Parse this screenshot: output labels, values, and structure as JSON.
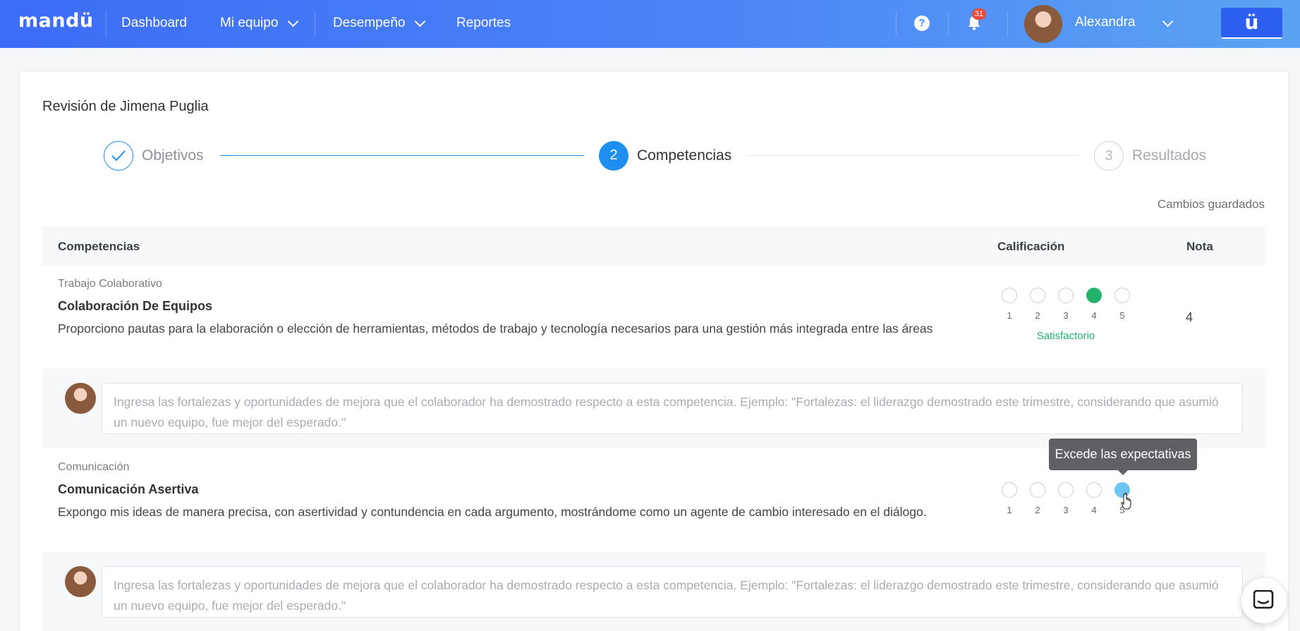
{
  "nav": {
    "logo": "mandü",
    "items": [
      {
        "label": "Dashboard"
      },
      {
        "label": "Mi equipo"
      },
      {
        "label": "Desempeño"
      },
      {
        "label": "Reportes"
      }
    ],
    "help_icon": "question-circle-icon",
    "notifications_count": "31",
    "user_name": "Alexandra",
    "brand_button": "ü",
    "accent_color": "#3d6cf5"
  },
  "review": {
    "title": "Revisión de Jimena Puglia",
    "steps": [
      {
        "number": "1",
        "label": "Objetivos",
        "state": "done"
      },
      {
        "number": "2",
        "label": "Competencias",
        "state": "active"
      },
      {
        "number": "3",
        "label": "Resultados",
        "state": "todo"
      }
    ],
    "saved_status": "Cambios guardados"
  },
  "table": {
    "headers": {
      "competencias": "Competencias",
      "calificacion": "Calificación",
      "nota": "Nota"
    },
    "rows": [
      {
        "category": "Trabajo Colaborativo",
        "name": "Colaboración De Equipos",
        "description": "Proporciono pautas para la elaboración o elección de herramientas, métodos de trabajo y tecnología necesarios para una gestión más integrada entre las áreas",
        "scale": [
          "1",
          "2",
          "3",
          "4",
          "5"
        ],
        "selected": 4,
        "rating_label": "Satisfactorio",
        "nota": "4",
        "comment_placeholder": "Ingresa las fortalezas y oportunidades de mejora que el colaborador ha demostrado respecto a esta competencia. Ejemplo: \"Fortalezas: el liderazgo demostrado este trimestre, considerando que asumió un nuevo equipo, fue mejor del esperado.\""
      },
      {
        "category": "Comunicación",
        "name": "Comunicación Asertiva",
        "description": "Expongo mis ideas de manera precisa, con asertividad y contundencia en cada argumento, mostrándome como un agente de cambio interesado en el diálogo.",
        "scale": [
          "1",
          "2",
          "3",
          "4",
          "5"
        ],
        "hovered": 5,
        "tooltip": "Excede las expectativas",
        "comment_placeholder": "Ingresa las fortalezas y oportunidades de mejora que el colaborador ha demostrado respecto a esta competencia. Ejemplo: \"Fortalezas: el liderazgo demostrado este trimestre, considerando que asumió un nuevo equipo, fue mejor del esperado.\""
      }
    ]
  },
  "colors": {
    "step_active": "#1e8fee",
    "rating_selected": "#24b36b",
    "rating_hover": "#6ec4f2"
  }
}
